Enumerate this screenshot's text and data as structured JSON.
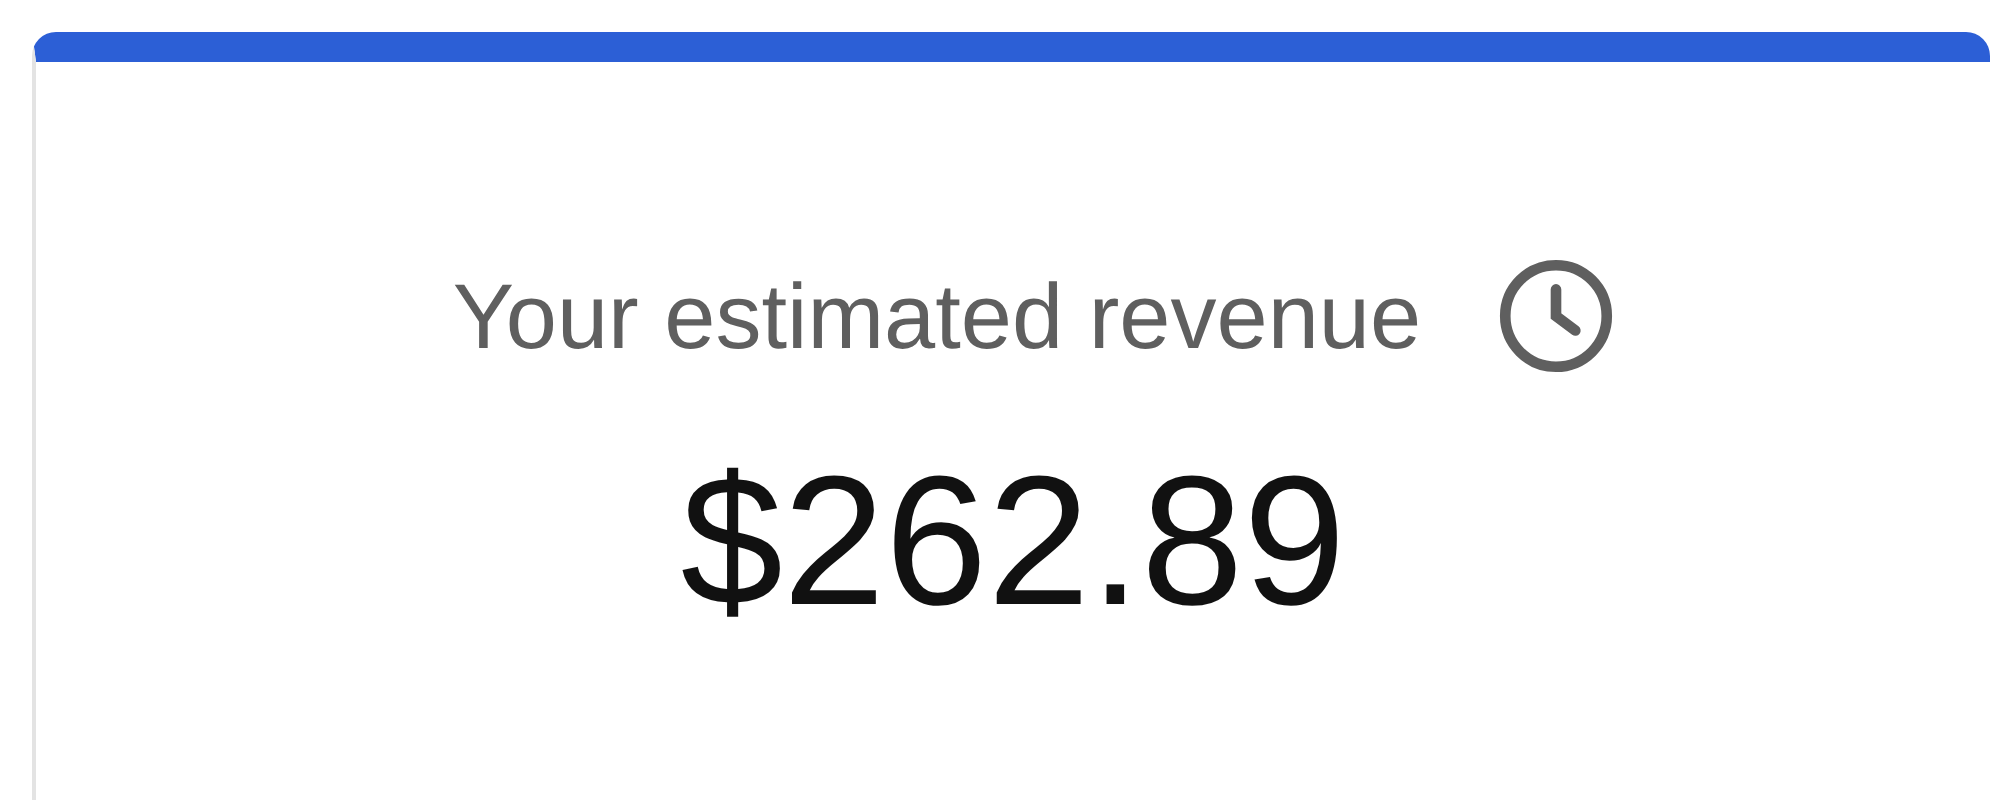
{
  "card": {
    "title": "Your estimated revenue",
    "amount": "$262.89"
  }
}
